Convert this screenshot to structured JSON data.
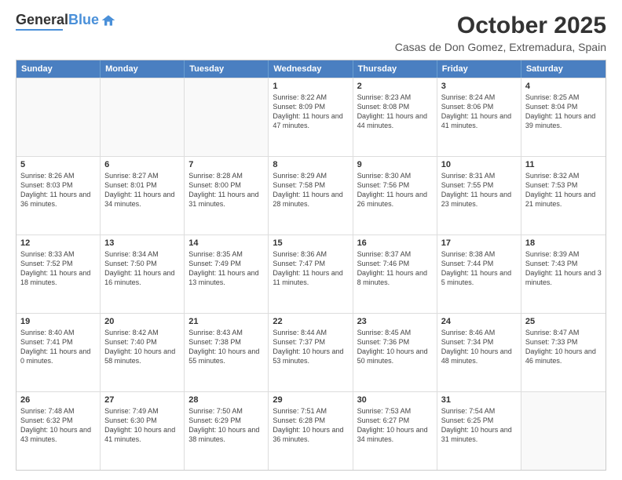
{
  "logo": {
    "line1": "General",
    "line2": "Blue"
  },
  "title": "October 2025",
  "location": "Casas de Don Gomez, Extremadura, Spain",
  "header_days": [
    "Sunday",
    "Monday",
    "Tuesday",
    "Wednesday",
    "Thursday",
    "Friday",
    "Saturday"
  ],
  "rows": [
    [
      {
        "day": "",
        "sunrise": "",
        "sunset": "",
        "daylight": ""
      },
      {
        "day": "",
        "sunrise": "",
        "sunset": "",
        "daylight": ""
      },
      {
        "day": "",
        "sunrise": "",
        "sunset": "",
        "daylight": ""
      },
      {
        "day": "1",
        "sunrise": "Sunrise: 8:22 AM",
        "sunset": "Sunset: 8:09 PM",
        "daylight": "Daylight: 11 hours and 47 minutes."
      },
      {
        "day": "2",
        "sunrise": "Sunrise: 8:23 AM",
        "sunset": "Sunset: 8:08 PM",
        "daylight": "Daylight: 11 hours and 44 minutes."
      },
      {
        "day": "3",
        "sunrise": "Sunrise: 8:24 AM",
        "sunset": "Sunset: 8:06 PM",
        "daylight": "Daylight: 11 hours and 41 minutes."
      },
      {
        "day": "4",
        "sunrise": "Sunrise: 8:25 AM",
        "sunset": "Sunset: 8:04 PM",
        "daylight": "Daylight: 11 hours and 39 minutes."
      }
    ],
    [
      {
        "day": "5",
        "sunrise": "Sunrise: 8:26 AM",
        "sunset": "Sunset: 8:03 PM",
        "daylight": "Daylight: 11 hours and 36 minutes."
      },
      {
        "day": "6",
        "sunrise": "Sunrise: 8:27 AM",
        "sunset": "Sunset: 8:01 PM",
        "daylight": "Daylight: 11 hours and 34 minutes."
      },
      {
        "day": "7",
        "sunrise": "Sunrise: 8:28 AM",
        "sunset": "Sunset: 8:00 PM",
        "daylight": "Daylight: 11 hours and 31 minutes."
      },
      {
        "day": "8",
        "sunrise": "Sunrise: 8:29 AM",
        "sunset": "Sunset: 7:58 PM",
        "daylight": "Daylight: 11 hours and 28 minutes."
      },
      {
        "day": "9",
        "sunrise": "Sunrise: 8:30 AM",
        "sunset": "Sunset: 7:56 PM",
        "daylight": "Daylight: 11 hours and 26 minutes."
      },
      {
        "day": "10",
        "sunrise": "Sunrise: 8:31 AM",
        "sunset": "Sunset: 7:55 PM",
        "daylight": "Daylight: 11 hours and 23 minutes."
      },
      {
        "day": "11",
        "sunrise": "Sunrise: 8:32 AM",
        "sunset": "Sunset: 7:53 PM",
        "daylight": "Daylight: 11 hours and 21 minutes."
      }
    ],
    [
      {
        "day": "12",
        "sunrise": "Sunrise: 8:33 AM",
        "sunset": "Sunset: 7:52 PM",
        "daylight": "Daylight: 11 hours and 18 minutes."
      },
      {
        "day": "13",
        "sunrise": "Sunrise: 8:34 AM",
        "sunset": "Sunset: 7:50 PM",
        "daylight": "Daylight: 11 hours and 16 minutes."
      },
      {
        "day": "14",
        "sunrise": "Sunrise: 8:35 AM",
        "sunset": "Sunset: 7:49 PM",
        "daylight": "Daylight: 11 hours and 13 minutes."
      },
      {
        "day": "15",
        "sunrise": "Sunrise: 8:36 AM",
        "sunset": "Sunset: 7:47 PM",
        "daylight": "Daylight: 11 hours and 11 minutes."
      },
      {
        "day": "16",
        "sunrise": "Sunrise: 8:37 AM",
        "sunset": "Sunset: 7:46 PM",
        "daylight": "Daylight: 11 hours and 8 minutes."
      },
      {
        "day": "17",
        "sunrise": "Sunrise: 8:38 AM",
        "sunset": "Sunset: 7:44 PM",
        "daylight": "Daylight: 11 hours and 5 minutes."
      },
      {
        "day": "18",
        "sunrise": "Sunrise: 8:39 AM",
        "sunset": "Sunset: 7:43 PM",
        "daylight": "Daylight: 11 hours and 3 minutes."
      }
    ],
    [
      {
        "day": "19",
        "sunrise": "Sunrise: 8:40 AM",
        "sunset": "Sunset: 7:41 PM",
        "daylight": "Daylight: 11 hours and 0 minutes."
      },
      {
        "day": "20",
        "sunrise": "Sunrise: 8:42 AM",
        "sunset": "Sunset: 7:40 PM",
        "daylight": "Daylight: 10 hours and 58 minutes."
      },
      {
        "day": "21",
        "sunrise": "Sunrise: 8:43 AM",
        "sunset": "Sunset: 7:38 PM",
        "daylight": "Daylight: 10 hours and 55 minutes."
      },
      {
        "day": "22",
        "sunrise": "Sunrise: 8:44 AM",
        "sunset": "Sunset: 7:37 PM",
        "daylight": "Daylight: 10 hours and 53 minutes."
      },
      {
        "day": "23",
        "sunrise": "Sunrise: 8:45 AM",
        "sunset": "Sunset: 7:36 PM",
        "daylight": "Daylight: 10 hours and 50 minutes."
      },
      {
        "day": "24",
        "sunrise": "Sunrise: 8:46 AM",
        "sunset": "Sunset: 7:34 PM",
        "daylight": "Daylight: 10 hours and 48 minutes."
      },
      {
        "day": "25",
        "sunrise": "Sunrise: 8:47 AM",
        "sunset": "Sunset: 7:33 PM",
        "daylight": "Daylight: 10 hours and 46 minutes."
      }
    ],
    [
      {
        "day": "26",
        "sunrise": "Sunrise: 7:48 AM",
        "sunset": "Sunset: 6:32 PM",
        "daylight": "Daylight: 10 hours and 43 minutes."
      },
      {
        "day": "27",
        "sunrise": "Sunrise: 7:49 AM",
        "sunset": "Sunset: 6:30 PM",
        "daylight": "Daylight: 10 hours and 41 minutes."
      },
      {
        "day": "28",
        "sunrise": "Sunrise: 7:50 AM",
        "sunset": "Sunset: 6:29 PM",
        "daylight": "Daylight: 10 hours and 38 minutes."
      },
      {
        "day": "29",
        "sunrise": "Sunrise: 7:51 AM",
        "sunset": "Sunset: 6:28 PM",
        "daylight": "Daylight: 10 hours and 36 minutes."
      },
      {
        "day": "30",
        "sunrise": "Sunrise: 7:53 AM",
        "sunset": "Sunset: 6:27 PM",
        "daylight": "Daylight: 10 hours and 34 minutes."
      },
      {
        "day": "31",
        "sunrise": "Sunrise: 7:54 AM",
        "sunset": "Sunset: 6:25 PM",
        "daylight": "Daylight: 10 hours and 31 minutes."
      },
      {
        "day": "",
        "sunrise": "",
        "sunset": "",
        "daylight": ""
      }
    ]
  ]
}
